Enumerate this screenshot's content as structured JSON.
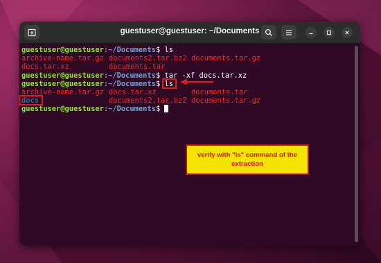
{
  "window": {
    "title": "guestuser@guestuser: ~/Documents",
    "buttons": {
      "new_tab_icon": "new-tab-icon",
      "search_icon": "search-icon",
      "menu_icon": "hamburger-menu-icon",
      "minimize_icon": "minimize-icon",
      "maximize_icon": "maximize-icon",
      "close_icon": "close-icon"
    }
  },
  "terminal": {
    "prompt_user": "guestuser@guestuser",
    "prompt_path": ":~/Documents",
    "prompt_symbol": "$",
    "line1_cmd": " ls",
    "line2": [
      "archive-name.tar.gz",
      "documents2.tar.bz2",
      "documents.tar.gz"
    ],
    "line3": [
      "docs.tar.xz",
      "documents.tar"
    ],
    "line4_cmd": " tar -xf docs.tar.xz",
    "line5_cmd": "ls",
    "line6": [
      "archive-name.tar.gz",
      "docs.tar.xz",
      "documents.tar"
    ],
    "line7": [
      "docs",
      "documents2.tar.bz2",
      "documents.tar.gz"
    ]
  },
  "annotation": {
    "callout_text": "verify with \"ls\" command of the extraction"
  },
  "colors": {
    "terminal_bg": "#300a24",
    "user_green": "#8ae234",
    "path_blue": "#729fcf",
    "archive_red": "#ef2929",
    "dir_blue": "#3465a4",
    "callout_yellow": "#f5e400",
    "annotation_red": "#e01b1b"
  }
}
